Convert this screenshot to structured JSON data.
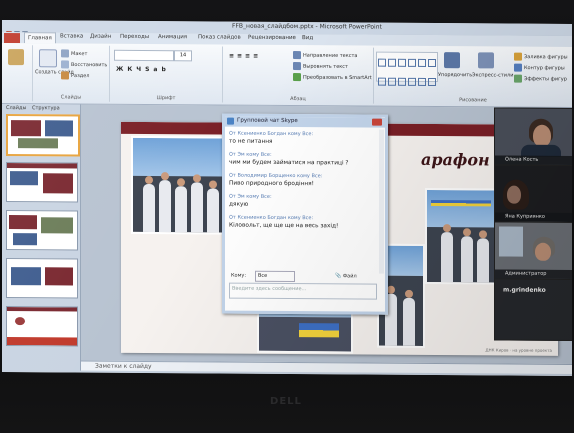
{
  "window": {
    "title": "FFB_новая_слайдбом.pptx - Microsoft PowerPoint"
  },
  "ribbon": {
    "tabs": [
      "Главная",
      "Вставка",
      "Дизайн",
      "Переходы",
      "Анимация",
      "Показ слайдов",
      "Рецензирование",
      "Вид"
    ],
    "active_tab": "Главная",
    "groups": {
      "slides": {
        "label": "Слайды",
        "create_label": "Создать слайд",
        "layout": "Макет",
        "reset": "Восстановить",
        "section": "Раздел"
      },
      "font": {
        "label": "Шрифт",
        "size": "14"
      },
      "paragraph": {
        "label": "Абзац",
        "text_direction": "Направление текста",
        "align_text": "Выровнять текст",
        "smartart": "Преобразовать в SmartArt"
      },
      "drawing": {
        "label": "Рисование",
        "arrange": "Упорядочить",
        "quick_styles": "Экспресс-стили",
        "fill": "Заливка фигуры",
        "outline": "Контур фигуры",
        "effects": "Эффекты фигур"
      }
    }
  },
  "panes": {
    "slides_tab": "Слайды",
    "outline_tab": "Структура"
  },
  "slide": {
    "heading": "арафон",
    "footer": "ДНК Киров · на уровне проекта"
  },
  "notes": {
    "placeholder": "Заметки к слайду"
  },
  "chat": {
    "title": "Групповой чат Skype",
    "messages": [
      {
        "from": "От Ксениенко Богдан кому Все:",
        "text": "то не питання"
      },
      {
        "from": "От Эм кому Все:",
        "text": "чим ми будем займатися на практиці ?"
      },
      {
        "from": "От Володимир Борщенко кому Все:",
        "text": "Пиво природного бродіння!"
      },
      {
        "from": "От Эм кому Все:",
        "text": "дякую"
      },
      {
        "from": "От Ксениенко Богдан кому Все:",
        "text": "Кіловольт, ще ще ще на весь захід!"
      }
    ],
    "to_label": "Кому:",
    "to_value": "Все",
    "file_label": "Файл",
    "input_placeholder": "Введите здесь сообщение..."
  },
  "participants": [
    {
      "name": "Олена Кость"
    },
    {
      "name": "Яна Куприянко"
    },
    {
      "name": "Администратор"
    },
    {
      "name": "m.grindenko"
    }
  ],
  "device": {
    "brand": "DELL"
  }
}
